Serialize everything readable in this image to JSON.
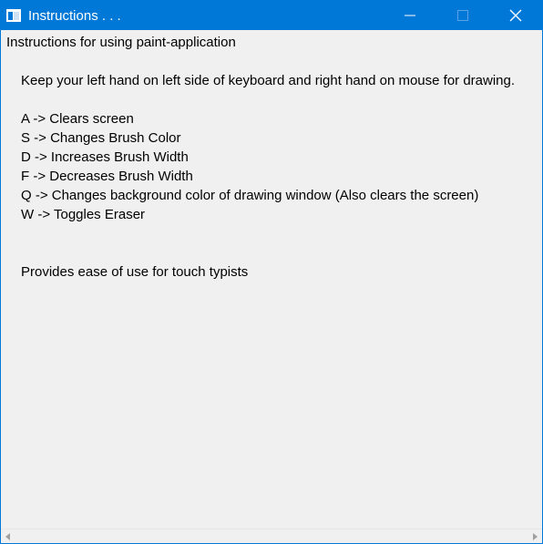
{
  "window": {
    "title": "Instructions . . ."
  },
  "content": {
    "heading": "Instructions for using paint-application",
    "intro": "Keep your left hand on left side of keyboard and right hand on mouse for drawing.",
    "shortcuts": [
      "A -> Clears screen",
      "S -> Changes Brush Color",
      "D -> Increases Brush Width",
      "F -> Decreases Brush Width",
      "Q -> Changes background color of drawing window (Also clears the screen)",
      "W -> Toggles Eraser"
    ],
    "footer": "Provides ease of use for touch typists"
  },
  "colors": {
    "titlebar": "#0078d7",
    "background": "#f0f0f0"
  },
  "icons": {
    "app": "window-icon",
    "minimize": "minimize-icon",
    "maximize": "maximize-icon",
    "close": "close-icon"
  }
}
